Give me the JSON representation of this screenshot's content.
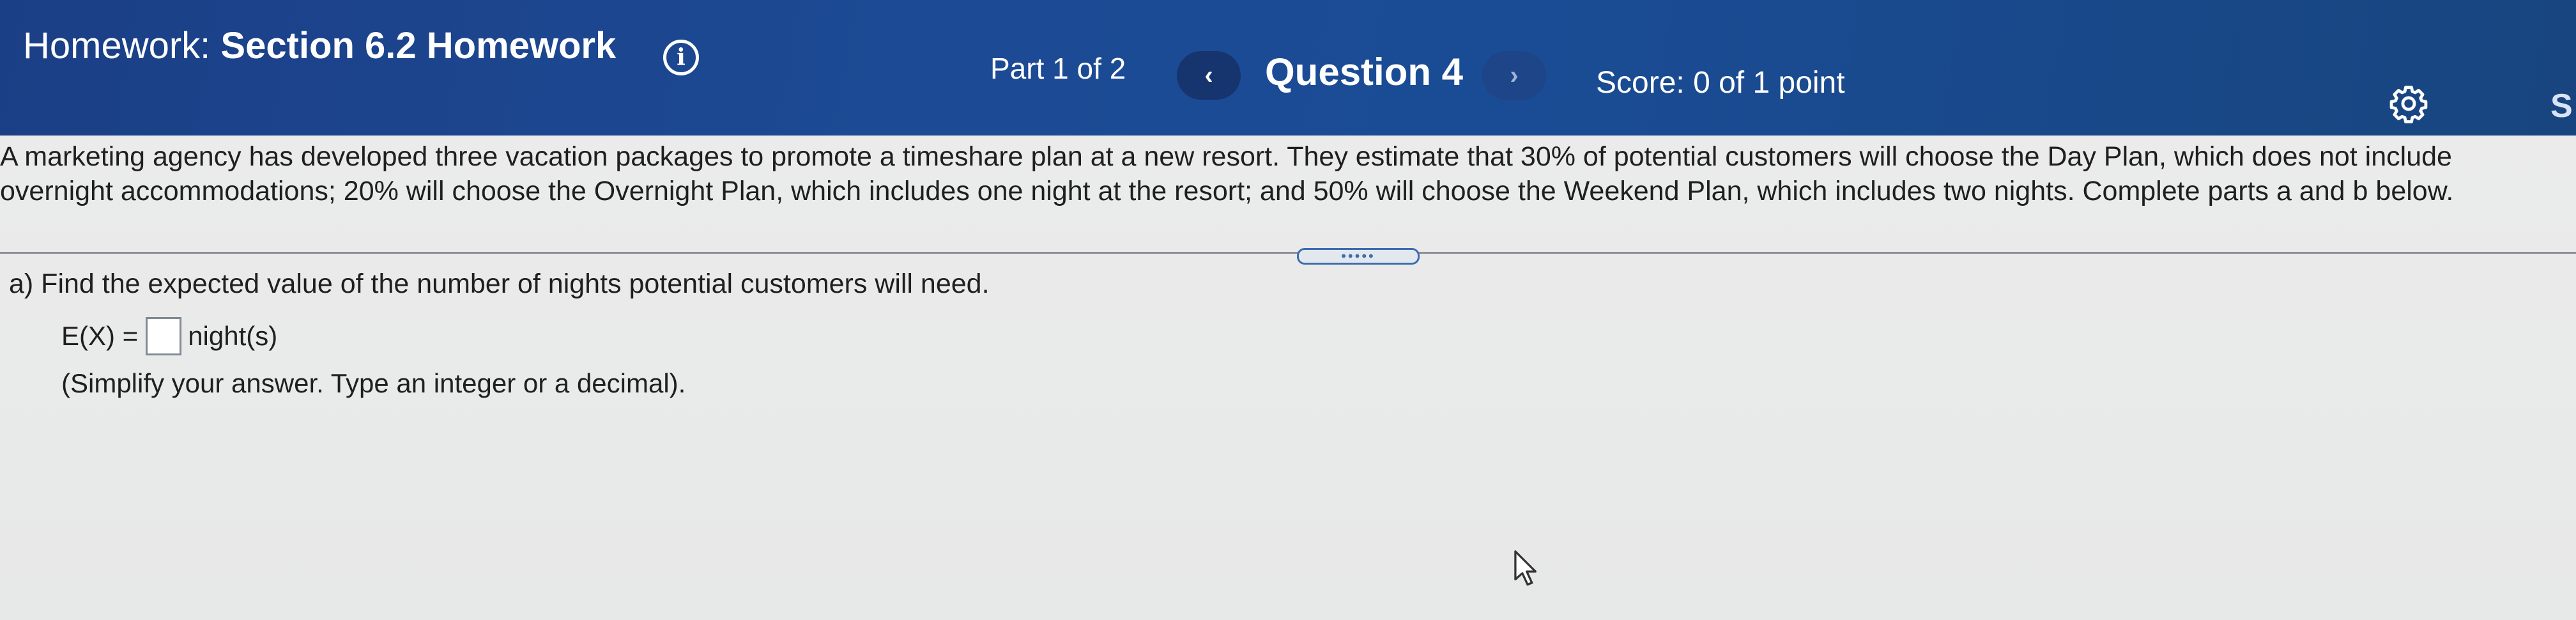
{
  "header": {
    "title_prefix": "Homework: ",
    "title_main": "Section 6.2 Homework",
    "info_glyph": "i",
    "part": "Part 1 of 2",
    "prev_glyph": "‹",
    "question": "Question 4",
    "next_glyph": "›",
    "score": "Score: 0 of 1 point",
    "user_initial": "S",
    "icons": {
      "info": "info-icon",
      "settings": "gear-icon"
    }
  },
  "question": {
    "text": "A marketing agency has developed three vacation packages to promote a timeshare plan at a new resort. They estimate that 30% of potential customers will choose the Day Plan, which does not include overnight accommodations; 20% will choose the Overnight Plan, which includes one night at the resort; and 50% will choose the Weekend Plan, which includes two nights. Complete parts a and b below."
  },
  "expand_label": "•••••",
  "part_a": {
    "prompt": "a) Find the expected value of the number of nights potential customers will need.",
    "answer_prefix": "E(X) =",
    "answer_value": "",
    "answer_unit": "night(s)",
    "hint": "(Simplify your answer. Type an integer or a decimal)."
  },
  "colors": {
    "header_bg": "#1c4a94",
    "header_text": "#ffffff",
    "body_bg": "#e9eaea",
    "accent": "#3c6db0"
  }
}
